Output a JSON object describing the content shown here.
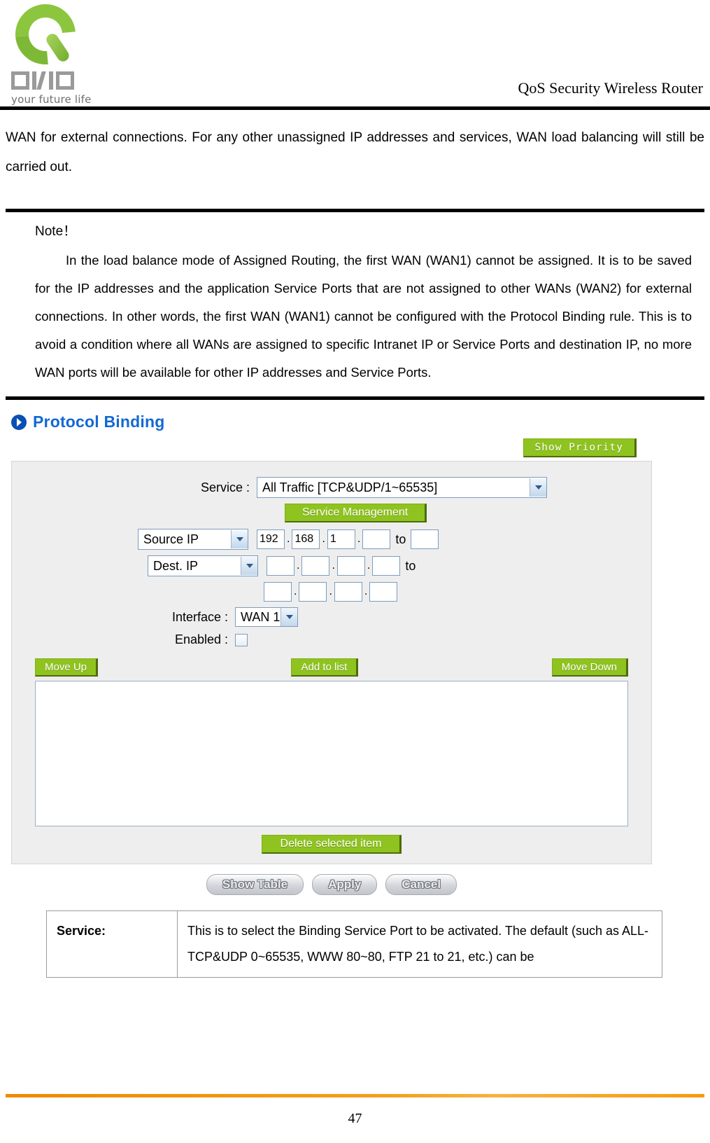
{
  "header": {
    "logo_alt": "QNO",
    "logo_letters": [
      "Q",
      "N",
      "O"
    ],
    "logo_tagline": "your future life",
    "doc_title": "QoS Security Wireless Router"
  },
  "body": {
    "paragraph": "WAN for external connections. For any other unassigned IP addresses and services, WAN load balancing will still be carried out."
  },
  "note": {
    "title": "Note！",
    "text": "In the load balance mode of Assigned Routing, the first WAN (WAN1) cannot be assigned. It is to be saved for the IP addresses and the application Service Ports that are not assigned to other WANs (WAN2) for external connections. In other words, the first WAN (WAN1) cannot be configured with the Protocol Binding rule. This is to avoid a condition where all WANs are assigned to specific Intranet IP or Service Ports and destination IP, no more WAN ports will be available for other IP addresses and Service Ports."
  },
  "screenshot": {
    "section_title": "Protocol Binding",
    "show_priority_label": "Show Priority",
    "service": {
      "label": "Service :",
      "selected": "All Traffic [TCP&UDP/1~65535]",
      "management_button": "Service Management"
    },
    "source_ip": {
      "selected": "Source IP",
      "octets": [
        "192",
        "168",
        "1",
        ""
      ],
      "to_label": "to",
      "to_octets": [
        ""
      ]
    },
    "dest_ip": {
      "selected": "Dest. IP",
      "octets": [
        "",
        "",
        "",
        ""
      ],
      "to_label": "to",
      "second_row_octets": [
        "",
        "",
        "",
        ""
      ]
    },
    "interface": {
      "label": "Interface :",
      "selected": "WAN 1"
    },
    "enabled": {
      "label": "Enabled :",
      "checked": false
    },
    "move_up_label": "Move Up",
    "add_to_list_label": "Add to list",
    "move_down_label": "Move Down",
    "list_items": [],
    "delete_selected_label": "Delete selected item",
    "show_table_label": "Show Table",
    "apply_label": "Apply",
    "cancel_label": "Cancel",
    "colors": {
      "button_green": "#8FC31F",
      "title_blue": "#1468D2",
      "panel_bg": "#EEEEEE"
    }
  },
  "description_table": {
    "rows": [
      {
        "key": "Service:",
        "value": "This is to select the Binding Service Port to be activated. The default (such as ALL-TCP&UDP 0~65535, WWW 80~80, FTP 21 to 21, etc.) can be"
      }
    ]
  },
  "footer": {
    "page_number": "47"
  }
}
